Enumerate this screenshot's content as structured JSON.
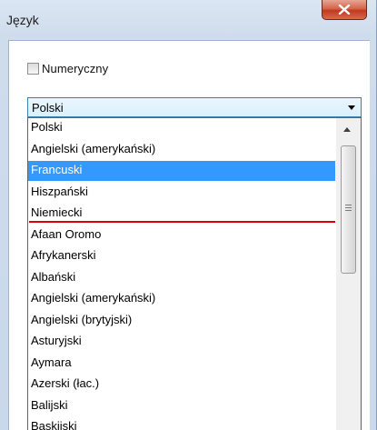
{
  "window": {
    "title": "Język",
    "close_icon": "close-x-icon"
  },
  "numeric_checkbox": {
    "label": "Numeryczny",
    "checked": false
  },
  "language_combo": {
    "value": "Polski",
    "arrow_icon": "chevron-down-icon"
  },
  "dropdown": {
    "options": [
      "Polski",
      "Angielski (amerykański)",
      "Francuski",
      "Hiszpański",
      "Niemiecki",
      "Afaan Oromo",
      "Afrykanerski",
      "Albański",
      "Angielski (amerykański)",
      "Angielski (brytyjski)",
      "Asturyjski",
      "Aymara",
      "Azerski (łac.)",
      "Balijski",
      "Baskijski"
    ],
    "selected_index": 2,
    "separator_after_index": 4,
    "separator_color": "#e00000",
    "selection_color": "#3399ff"
  },
  "scrollbar": {
    "up_icon": "scroll-up-arrow-icon",
    "grip_icon": "grip-icon"
  }
}
